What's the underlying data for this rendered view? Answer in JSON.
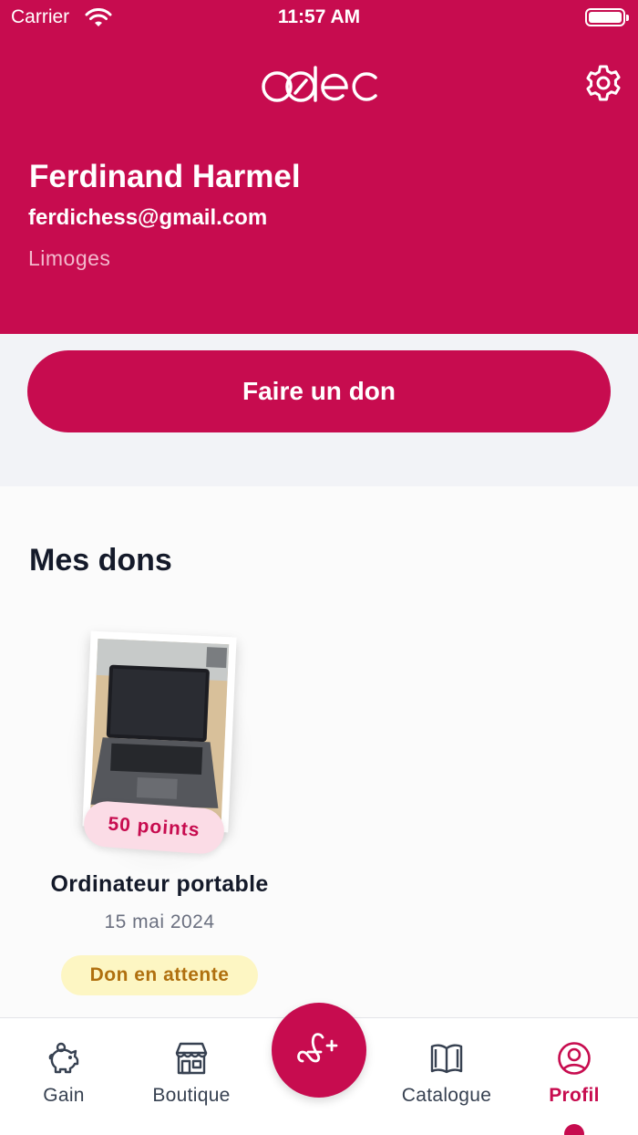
{
  "status_bar": {
    "carrier": "Carrier",
    "time": "11:57 AM"
  },
  "header": {
    "app_logo": "colec"
  },
  "profile": {
    "name": "Ferdinand Harmel",
    "email": "ferdichess@gmail.com",
    "city": "Limoges"
  },
  "actions": {
    "donate_label": "Faire un don"
  },
  "donations": {
    "title": "Mes dons",
    "items": [
      {
        "points": "50 points",
        "title": "Ordinateur portable",
        "date": "15 mai 2024",
        "status": "Don en attente"
      }
    ]
  },
  "tabbar": {
    "items": [
      {
        "label": "Gain",
        "icon": "piggy-bank-icon"
      },
      {
        "label": "Boutique",
        "icon": "store-icon"
      },
      {
        "label": "",
        "icon": "add-donation-icon"
      },
      {
        "label": "Catalogue",
        "icon": "book-icon"
      },
      {
        "label": "Profil",
        "icon": "user-circle-icon",
        "active": true
      }
    ]
  },
  "colors": {
    "brand": "#c70c4f",
    "badge_bg": "#fdf6c3",
    "badge_text": "#b0700f"
  }
}
